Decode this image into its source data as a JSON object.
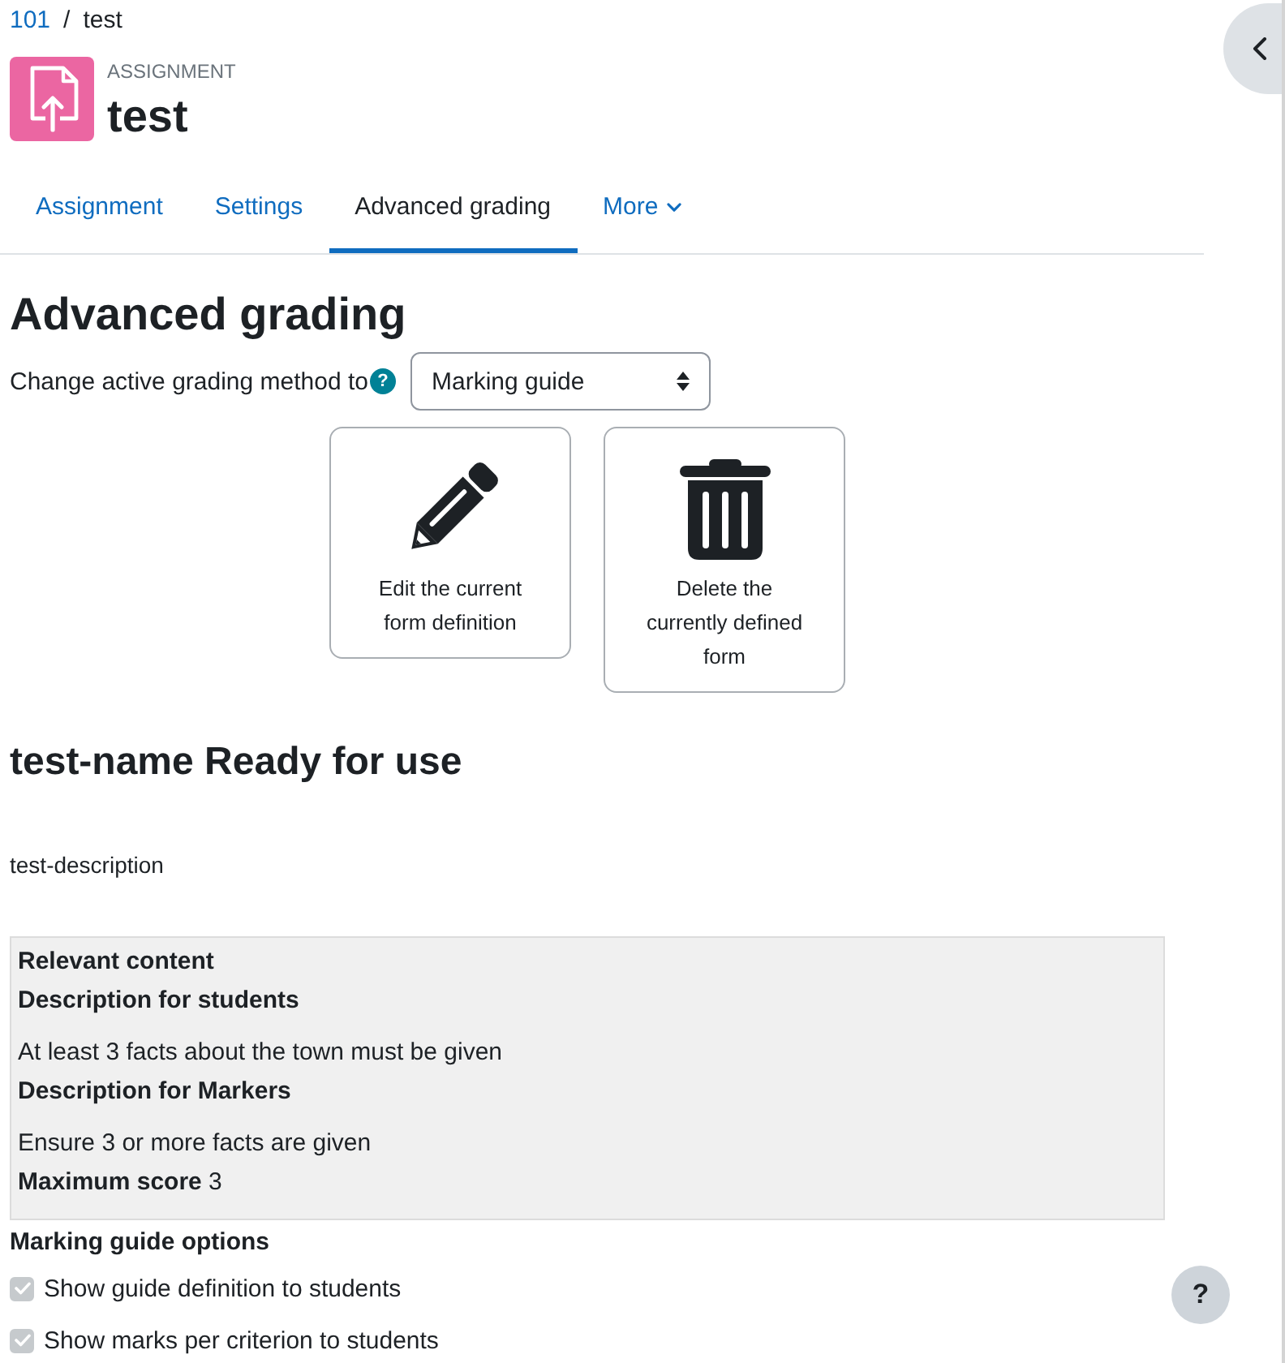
{
  "breadcrumb": {
    "separator": "/",
    "items": [
      {
        "label": "101",
        "current": false
      },
      {
        "label": "test",
        "current": true
      }
    ]
  },
  "header": {
    "module_type": "ASSIGNMENT",
    "title": "test"
  },
  "tabs": [
    {
      "label": "Assignment",
      "kind": "link",
      "selected": false
    },
    {
      "label": "Settings",
      "kind": "link",
      "selected": false
    },
    {
      "label": "Advanced grading",
      "kind": "link",
      "selected": true
    },
    {
      "label": "More",
      "kind": "menu",
      "selected": false
    }
  ],
  "page_title": "Advanced grading",
  "method": {
    "label": "Change active grading method to",
    "help": "?",
    "select": {
      "value": "Marking guide"
    }
  },
  "actions": [
    {
      "kind": "edit",
      "label": "Edit the current form definition"
    },
    {
      "kind": "delete",
      "label": "Delete the currently defined form"
    }
  ],
  "definition": {
    "title": "test-name Ready for use",
    "description": "test-description"
  },
  "criterion": {
    "lines": [
      {
        "kind": "heading",
        "text": "Relevant content"
      },
      {
        "kind": "heading",
        "text": "Description for students"
      },
      {
        "kind": "description",
        "text": "At least 3 facts about the town must be given"
      },
      {
        "kind": "heading",
        "text": "Description for Markers"
      },
      {
        "kind": "description",
        "text": "Ensure 3 or more facts are given"
      },
      {
        "kind": "score",
        "text": "**Maximum score** 3"
      }
    ]
  },
  "options": {
    "title": "Marking guide options",
    "items": [
      {
        "label": "Show guide definition to students",
        "checked": true,
        "disabled": true
      },
      {
        "label": "Show marks per criterion to students",
        "checked": true,
        "disabled": true
      }
    ]
  },
  "help_button": {
    "label": "?"
  }
}
